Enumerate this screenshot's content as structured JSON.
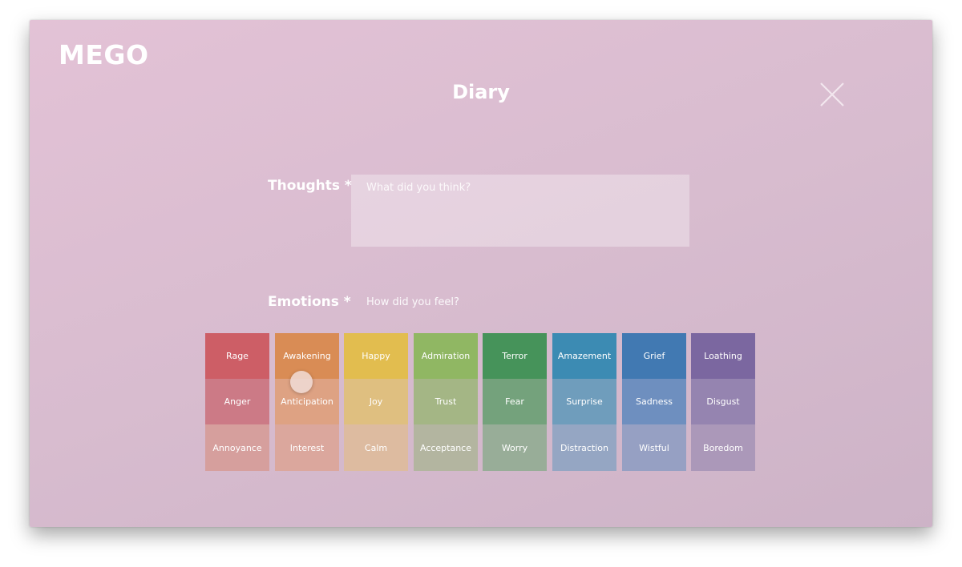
{
  "app": {
    "logo": "MEGO",
    "title": "Diary"
  },
  "thoughts": {
    "label": "Thoughts *",
    "placeholder": "What did you think?"
  },
  "emotions": {
    "label": "Emotions *",
    "hint": "How did you feel?",
    "columns": [
      {
        "colors": [
          "#cd5e66",
          "#cc7a86",
          "#d69f9d"
        ],
        "items": [
          "Rage",
          "Anger",
          "Annoyance"
        ]
      },
      {
        "colors": [
          "#d98c55",
          "#dea283",
          "#dba79d"
        ],
        "items": [
          "Awakening",
          "Anticipation",
          "Interest"
        ]
      },
      {
        "colors": [
          "#e2bd4f",
          "#dfbf80",
          "#ddbba0"
        ],
        "items": [
          "Happy",
          "Joy",
          "Calm"
        ]
      },
      {
        "colors": [
          "#90b763",
          "#a4b685",
          "#b3b5a0"
        ],
        "items": [
          "Admiration",
          "Trust",
          "Acceptance"
        ]
      },
      {
        "colors": [
          "#46935a",
          "#74a27c",
          "#98ad98"
        ],
        "items": [
          "Terror",
          "Fear",
          "Worry"
        ]
      },
      {
        "colors": [
          "#3c8bb3",
          "#6f9dbc",
          "#95a6c3"
        ],
        "items": [
          "Amazement",
          "Surprise",
          "Distraction"
        ]
      },
      {
        "colors": [
          "#4179b2",
          "#6e8fbf",
          "#96a0c3"
        ],
        "items": [
          "Grief",
          "Sadness",
          "Wistful"
        ]
      },
      {
        "colors": [
          "#7b67a0",
          "#9584b0",
          "#ab98b9"
        ],
        "items": [
          "Loathing",
          "Disgust",
          "Boredom"
        ]
      }
    ]
  },
  "icons": {
    "close": "close-icon"
  }
}
